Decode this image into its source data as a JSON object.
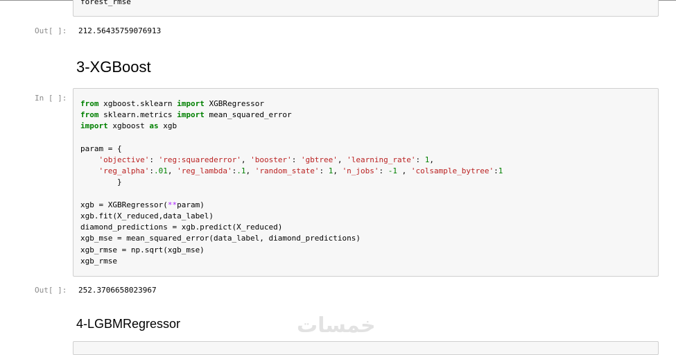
{
  "top_cell": {
    "code_tail": "forest_rmse"
  },
  "out1": {
    "prompt": "Out[ ]:",
    "value": "212.56435759076913"
  },
  "heading_xgb": "3-XGBoost",
  "xgb_cell": {
    "prompt": "In [ ]:",
    "tokens": {
      "from": "from",
      "import": "import",
      "as": "as",
      "mod_xgb_sklearn": "xgboost.sklearn",
      "cls_xgbregressor": "XGBRegressor",
      "mod_sklearn_metrics": "sklearn.metrics",
      "fn_mse": "mean_squared_error",
      "mod_xgboost": "xgboost",
      "alias_xgb": "xgb",
      "param_open": "param = {",
      "s_objective": "'objective'",
      "s_reg_sq": "'reg:squarederror'",
      "s_booster": "'booster'",
      "s_gbtree": "'gbtree'",
      "s_lr": "'learning_rate'",
      "n_1": "1",
      "s_reg_alpha": "'reg_alpha'",
      "n_01": ".01",
      "s_reg_lambda": "'reg_lambda'",
      "n_1b": ".1",
      "s_random_state": "'random_state'",
      "s_n_jobs": "'n_jobs'",
      "n_neg1": "-1",
      "s_colsample": "'colsample_bytree'",
      "brace_close": "}",
      "xgb_assign": "xgb = XGBRegressor(",
      "dstar": "**",
      "param_close": "param)",
      "line_fit": "xgb.fit(X_reduced,data_label)",
      "line_pred": "diamond_predictions = xgb.predict(X_reduced)",
      "line_mse": "xgb_mse = mean_squared_error(data_label, diamond_predictions)",
      "line_rmse": "xgb_rmse = np.sqrt(xgb_mse)",
      "line_out": "xgb_rmse"
    }
  },
  "out2": {
    "prompt": "Out[ ]:",
    "value": "252.3706658023967"
  },
  "heading_lgbm": "4-LGBMRegressor",
  "watermark": "خمسات"
}
